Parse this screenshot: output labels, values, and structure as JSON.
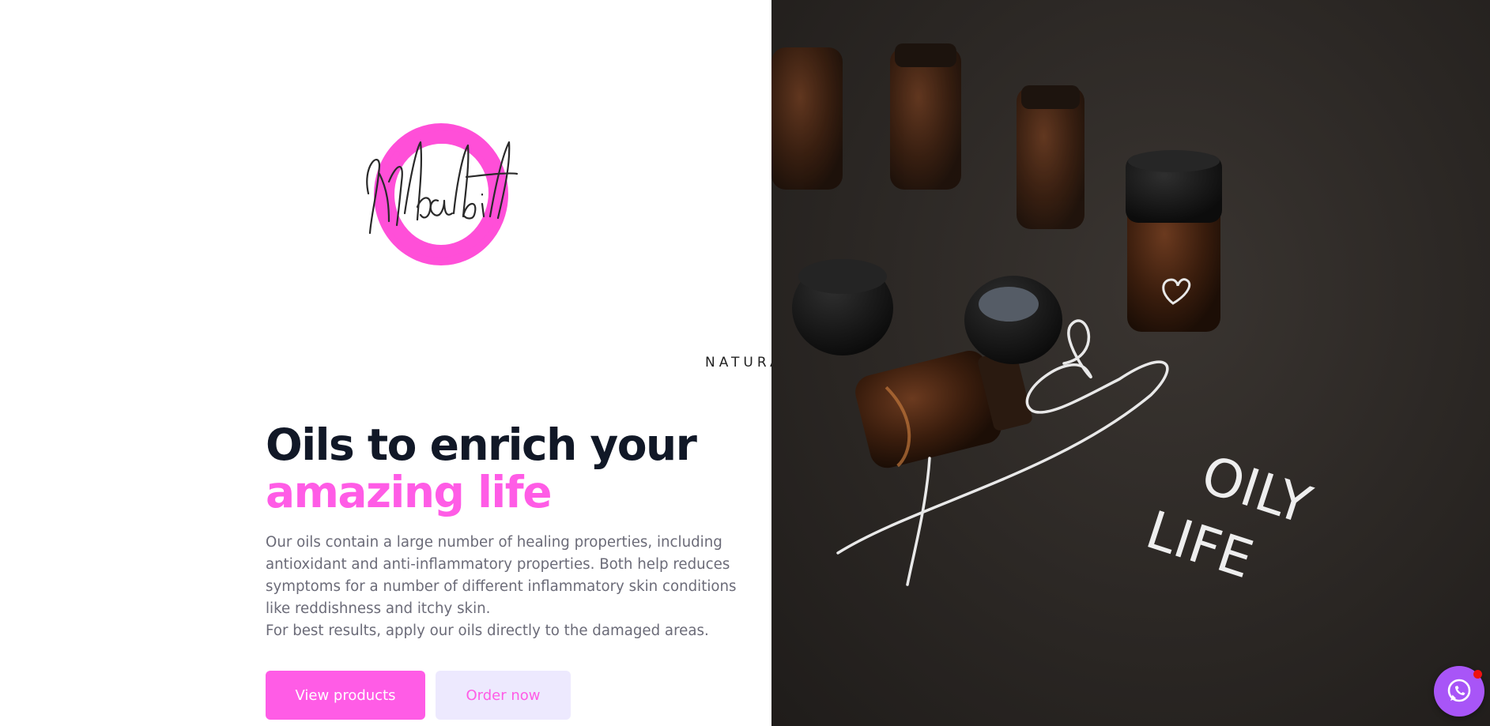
{
  "brand": {
    "logo_script": "Mhabil",
    "logo_tagline": "NATURAL OILS",
    "accent_color": "#ff5ce6",
    "ring_color": "#ff4fd8"
  },
  "hero": {
    "headline_line1": "Oils to enrich your",
    "headline_line2": "amazing life",
    "paragraph1": "Our oils contain a large number of healing properties, including antioxidant and anti-inflammatory properties. Both help reduces symptoms for a number of different inflammatory skin conditions like reddishness and itchy skin.",
    "paragraph2": "For best results, apply our oils directly to the damaged areas."
  },
  "buttons": {
    "primary_label": "View products",
    "secondary_label": "Order now"
  },
  "photo": {
    "chalk_text_line1": "OILY",
    "chalk_text_line2": "LIFE"
  },
  "chat": {
    "icon": "whatsapp-icon",
    "button_color": "#a855f7",
    "badge_color": "#ef1111"
  }
}
